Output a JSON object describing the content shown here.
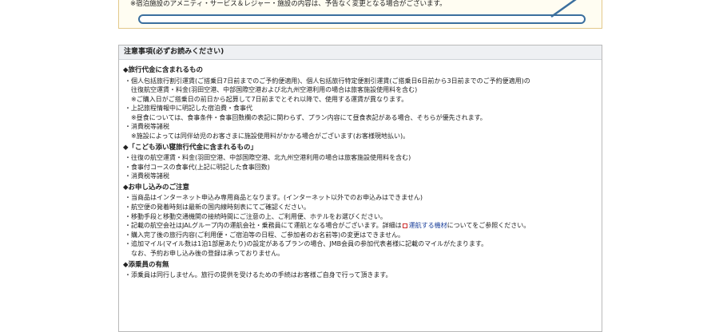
{
  "top": {
    "note": "※宿泊施設のアメニティ・サービス＆レジャー・施設の内容は、予告なく変更となる場合がございます。"
  },
  "notice": {
    "heading": "注意事項(必ずお読みください)",
    "sections": [
      {
        "title": "◆旅行代金に含まれるもの",
        "lines": [
          {
            "type": "item",
            "text": "個人包括旅行割引運賃(ご搭乗日7日前までのご予約便適用)、個人包括旅行特定便割引運賃(ご搭乗日6日前から3日前までのご予約便適用)の"
          },
          {
            "type": "sub",
            "text": "往復航空運賃・料金(羽田空港、中部国際空港および北九州空港利用の場合は旅客施設使用料を含む)"
          },
          {
            "type": "sub",
            "text": "※ご購入日がご搭乗日の前日から起算して7日前までとそれ以降で、使用する運賃が異なります。"
          },
          {
            "type": "item",
            "text": "上記旅程情報中に明記した宿泊費・食事代"
          },
          {
            "type": "sub",
            "text": "※昼食については、食事条件・食事回数欄の表記に関わらず、プラン内容にて昼食表記がある場合、そちらが優先されます。"
          },
          {
            "type": "item",
            "text": "消費税等諸税"
          },
          {
            "type": "sub",
            "text": "※施設によっては同伴幼児のお客さまに施設使用料がかかる場合がございます(お客様現地払い)。"
          }
        ]
      },
      {
        "title": "◆「こども添い寝旅行代金に含まれるもの」",
        "lines": [
          {
            "type": "item",
            "text": "往復の航空運賃・料金(羽田空港、中部国際空港、北九州空港利用の場合は旅客施設使用料を含む)"
          },
          {
            "type": "item",
            "text": "食事付コースの食事代(上記に明記した食事回数)"
          },
          {
            "type": "item",
            "text": "消費税等諸税"
          }
        ]
      },
      {
        "title": "◆お申し込みのご注意",
        "lines": [
          {
            "type": "item",
            "text": "当商品はインターネット申込み専用商品となります。(インターネット以外でのお申込みはできません)"
          },
          {
            "type": "item",
            "text": "航空便の発着時刻は最新の国内線時刻表にてご確認ください。"
          },
          {
            "type": "item",
            "text": "移動手段と移動交通機関の接続時間にご注意の上、ご利用便、ホテルをお選びください。"
          },
          {
            "type": "link",
            "text": "記載の航空会社はJALグループ内の運航会社・乗務員にて運航となる場合がございます。詳細は",
            "link": "運航する機材",
            "after": "についてをご参照ください。"
          },
          {
            "type": "item",
            "text": "購入完了後の旅行内容(ご利用便・ご宿泊等の日程、ご参加者のお名前等)の変更はできません。"
          },
          {
            "type": "item",
            "text": "追加マイル(マイル数は1泊1部屋あたり)の設定があるプランの場合、JMB会員の参加代表者様に記載のマイルがたまります。"
          },
          {
            "type": "sub",
            "text": "なお、予約お申し込み後の登録は承っておりません。"
          }
        ]
      },
      {
        "title": "◆添乗員の有無",
        "lines": [
          {
            "type": "item",
            "text": "添乗員は同行しません。旅行の提供を受けるための手続はお客様ご自身で行って頂きます。"
          }
        ]
      }
    ]
  },
  "bullet": "・",
  "colors": {
    "link": "#1a3f9a",
    "pill_border": "#3b6f9e",
    "top_border": "#e3c88a",
    "icon": "#cc2a2a"
  }
}
